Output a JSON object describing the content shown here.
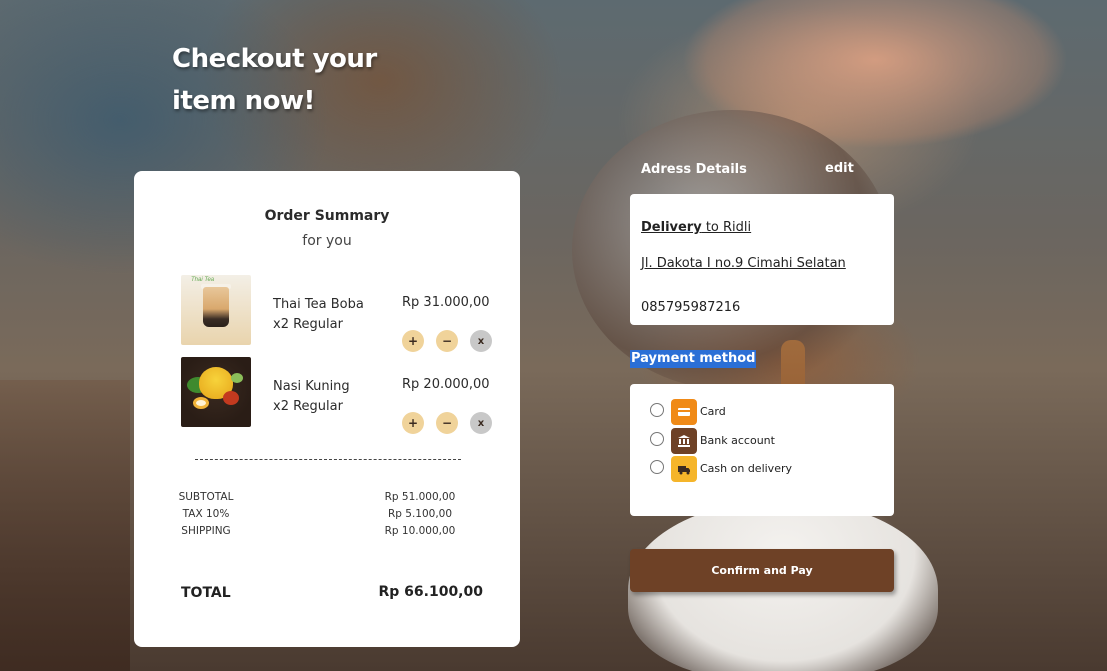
{
  "headline": {
    "line1": "Checkout your",
    "line2": "item now!"
  },
  "order_summary": {
    "title": "Order Summary",
    "subtitle": "for you",
    "items": [
      {
        "name": "Thai Tea Boba",
        "variant": "x2 Regular",
        "price": "Rp 31.000,00",
        "image": "thai-tea-boba-photo",
        "image_caption": "Thai Tea"
      },
      {
        "name": "Nasi Kuning",
        "variant": "x2 Regular",
        "price": "Rp 20.000,00",
        "image": "nasi-kuning-photo"
      }
    ],
    "controls": {
      "plus": "+",
      "minus": "−",
      "remove": "x"
    },
    "divider": "-------------------------------------------",
    "lines": [
      {
        "label": "SUBTOTAL",
        "value": "Rp 51.000,00"
      },
      {
        "label": "TAX 10%",
        "value": "Rp 5.100,00"
      },
      {
        "label": "SHIPPING",
        "value": "Rp 10.000,00"
      }
    ],
    "total_label": "TOTAL",
    "total_value": "Rp 66.100,00"
  },
  "address": {
    "heading": "Adress Details",
    "edit_label": "edit",
    "delivery_prefix": "Delivery",
    "delivery_suffix": " to Ridli",
    "street": "Jl. Dakota I no.9 Cimahi Selatan",
    "phone": "085795987216"
  },
  "payment": {
    "heading": "Payment method",
    "options": [
      {
        "label": "Card",
        "icon": "card-icon",
        "color": "#f08a17"
      },
      {
        "label": "Bank account",
        "icon": "bank-icon",
        "color": "#6e4126"
      },
      {
        "label": "Cash on delivery",
        "icon": "truck-icon",
        "color": "#f5b52a"
      }
    ]
  },
  "confirm_label": "Confirm and Pay",
  "colors": {
    "accent_brown": "#6e4126",
    "qty_button": "#f0d39a",
    "selection_highlight": "#2b6fd6"
  }
}
